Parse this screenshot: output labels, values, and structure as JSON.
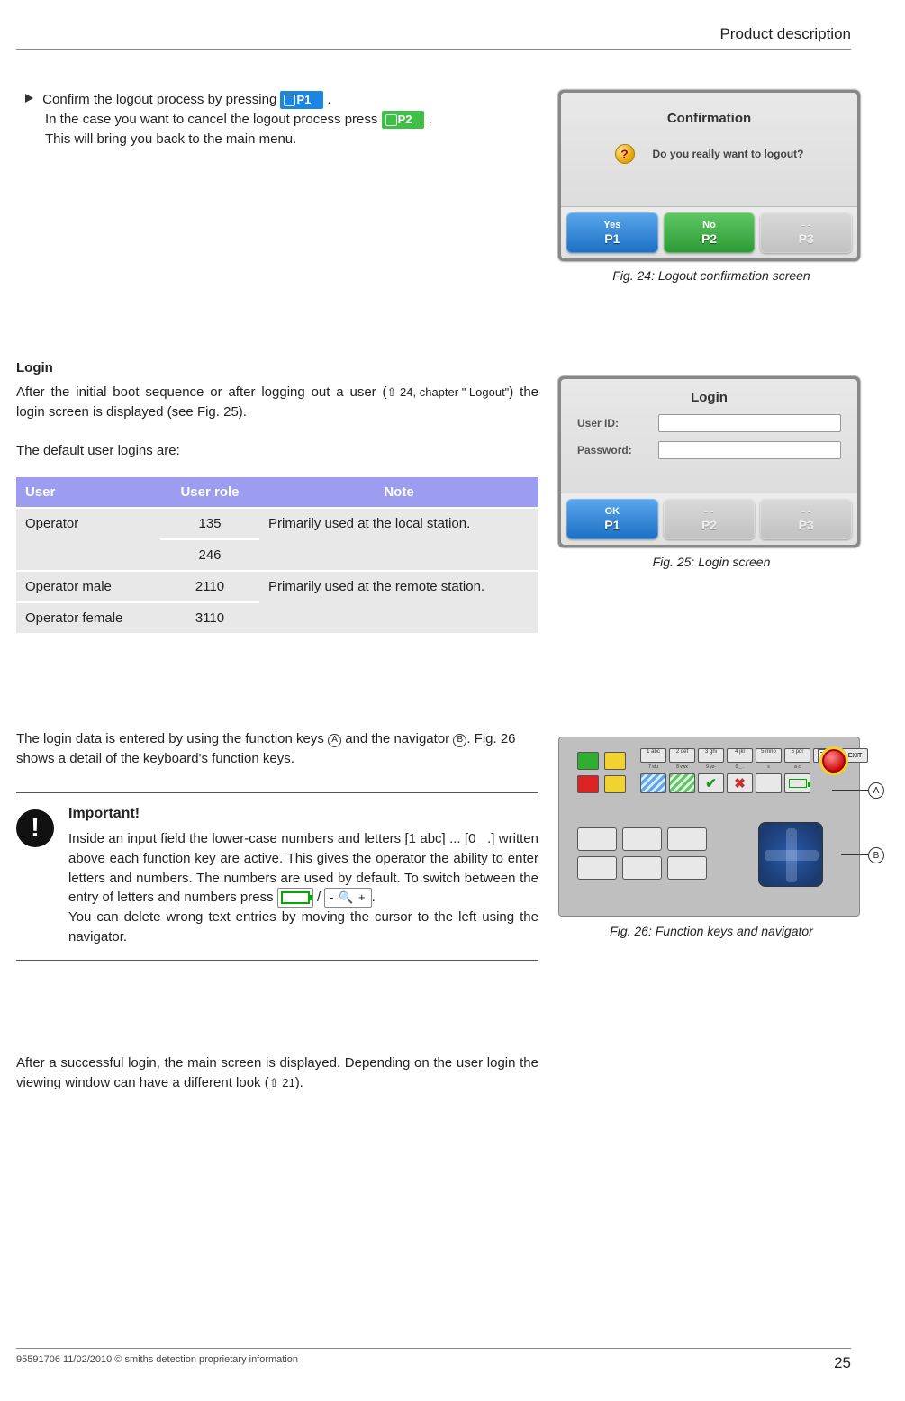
{
  "header": {
    "title": "Product description"
  },
  "logout_section": {
    "line1_prefix": "Confirm the logout process by pressing ",
    "p1_label": "P1",
    "line1_suffix": ".",
    "line2_prefix": "In the case you want to cancel the logout process press ",
    "p2_label": "P2",
    "line2_suffix": ".",
    "line3": "This will bring you back to the main menu."
  },
  "fig24": {
    "title": "Confirmation",
    "question": "Do you really want to logout?",
    "buttons": [
      {
        "top": "Yes",
        "key": "P1",
        "style": "blue"
      },
      {
        "top": "No",
        "key": "P2",
        "style": "green"
      },
      {
        "top": "- -",
        "key": "P3",
        "style": "grey"
      }
    ],
    "caption": "Fig. 24: Logout confirmation screen"
  },
  "login_section": {
    "heading": "Login",
    "intro_a": "After the initial boot sequence or after logging out a user (",
    "intro_ref": "⇧ 24, chapter \" Logout\"",
    "intro_b": ") the login screen is displayed (see Fig. 25).",
    "default_line": "The default user logins are:"
  },
  "login_table": {
    "headers": {
      "user": "User",
      "role": "User role",
      "note": "Note"
    },
    "rows": [
      {
        "user": "Operator",
        "role": "135",
        "note": "Primarily used at the local sta­tion."
      },
      {
        "user": "",
        "role": "246",
        "note": ""
      },
      {
        "user": "Operator male",
        "role": "2110",
        "note": "Primarily used at the remote sta­tion."
      },
      {
        "user": "Operator female",
        "role": "3110",
        "note": ""
      }
    ]
  },
  "fig25": {
    "title": "Login",
    "userid_label": "User ID:",
    "password_label": "Password:",
    "buttons": [
      {
        "top": "OK",
        "key": "P1",
        "style": "blue"
      },
      {
        "top": "- -",
        "key": "P2",
        "style": "grey"
      },
      {
        "top": "- -",
        "key": "P3",
        "style": "grey"
      }
    ],
    "caption": "Fig. 25: Login screen"
  },
  "login_data_text": {
    "a": "The login data is entered by using the function keys ",
    "A": "A",
    "b": " and the nav­igator ",
    "B": "B",
    "c": ". Fig. 26 shows a detail of the keyboard's function keys."
  },
  "important": {
    "title": "Important!",
    "body_a": "Inside an input field the lower-case numbers and letters [1 abc] ... [0 _.] written above each function key are act­ive. This gives the operator the ability to enter letters and numbers. The numbers are used by default. To switch between the entry of letters and numbers press ",
    "zoom": "- 🔍 +",
    "body_b": ".",
    "body_c": "You can delete wrong text entries by moving the cursor to the left using the navigator."
  },
  "after_login": {
    "a": "After a successful login, the main screen is displayed. Depending on the user login the viewing window can have a different look (",
    "ref": "⇧ 21",
    "b": ")."
  },
  "fig26": {
    "top_labels": [
      "1  abc",
      "2  def",
      "3  ghi",
      "4  jkl",
      "5 mno",
      "6  pqr"
    ],
    "bot_labels": [
      "7  stu",
      "8  vwx",
      "9  yz-",
      "0  _ .",
      "s",
      "a      c"
    ],
    "exit": "EXIT",
    "callout_A": "A",
    "callout_B": "B",
    "caption": "Fig. 26: Function keys and navigator"
  },
  "footer": {
    "left": "95591706 11/02/2010 © smiths detection proprietary information",
    "page": "25"
  }
}
